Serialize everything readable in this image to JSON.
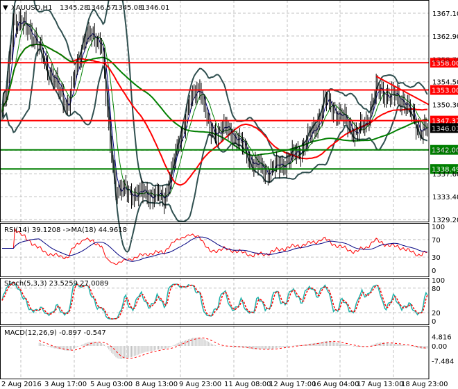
{
  "header": {
    "symbol": "XAUUSD,H1",
    "open": "1345.28",
    "high": "1346.57",
    "low": "1345.08",
    "close": "1346.01"
  },
  "colors": {
    "level_red": "#ff0000",
    "level_green": "#007f00",
    "ma_red": "#ff0000",
    "ma_green": "#007f00",
    "bands": "#2f4f4f",
    "rsi": "#ff0000",
    "rsi_ma": "#000080",
    "stoch_main": "#20b2aa",
    "stoch_signal": "#ff0000",
    "macd_hist": "#c0c0c0",
    "macd_signal": "#ff0000"
  },
  "chart_data": {
    "type": "candlestick",
    "title": "XAUUSD,H1",
    "price_ticks": [
      "1367.10",
      "1362.90",
      "1358.70",
      "1354.50",
      "1350.30",
      "1346.10",
      "1341.90",
      "1337.60",
      "1333.40",
      "1329.20"
    ],
    "price_ylim": [
      1329.2,
      1367.1
    ],
    "price_anchors": [
      [
        0,
        1349
      ],
      [
        3,
        1352
      ],
      [
        8,
        1366
      ],
      [
        20,
        1364
      ],
      [
        34,
        1356
      ],
      [
        46,
        1350
      ],
      [
        58,
        1363
      ],
      [
        70,
        1362
      ],
      [
        75,
        1345
      ],
      [
        80,
        1335
      ],
      [
        90,
        1334
      ],
      [
        102,
        1334
      ],
      [
        114,
        1333
      ],
      [
        122,
        1341
      ],
      [
        131,
        1350
      ],
      [
        139,
        1354
      ],
      [
        146,
        1345
      ],
      [
        156,
        1346
      ],
      [
        166,
        1344
      ],
      [
        175,
        1340
      ],
      [
        185,
        1338
      ],
      [
        195,
        1339
      ],
      [
        210,
        1342
      ],
      [
        220,
        1346
      ],
      [
        227,
        1351
      ],
      [
        239,
        1348
      ],
      [
        249,
        1345
      ],
      [
        256,
        1347
      ],
      [
        263,
        1353
      ],
      [
        273,
        1352
      ],
      [
        283,
        1351
      ],
      [
        292,
        1346
      ]
    ],
    "levels": [
      {
        "label": "1358.00",
        "value": 1358.0,
        "color": "red"
      },
      {
        "label": "1353.00",
        "value": 1353.0,
        "color": "red"
      },
      {
        "label": "1347.37",
        "value": 1347.37,
        "color": "red"
      },
      {
        "label": "1342.00",
        "value": 1342.0,
        "color": "green"
      },
      {
        "label": "1338.49",
        "value": 1338.49,
        "color": "green"
      }
    ],
    "current_price": {
      "label": "1346.01",
      "value": 1346.01
    },
    "trendline": [
      [
        263,
        1355.5
      ],
      [
        300,
        1350.3
      ]
    ],
    "time_labels": [
      "2 Aug 2016",
      "3 Aug 17:00",
      "5 Aug 03:00",
      "8 Aug 13:00",
      "9 Aug 23:00",
      "11 Aug 08:00",
      "12 Aug 17:00",
      "16 Aug 04:00",
      "17 Aug 13:00",
      "18 Aug 23:00"
    ],
    "rsi": {
      "label": "RSI(14) 39.1208  ->MA(18) 44.9618",
      "ticks": [
        "100",
        "70",
        "30",
        "0"
      ],
      "ylim": [
        0,
        100
      ]
    },
    "stoch": {
      "label": "Stoch(5,3,3) 23.5259 27.0089",
      "ticks": [
        "100",
        "80",
        "20",
        "0"
      ],
      "ylim": [
        0,
        100
      ]
    },
    "macd": {
      "label": "MACD(12,26,9) -0.897 -0.547",
      "ticks": [
        "4.816",
        "0.00",
        "-7.484"
      ],
      "ylim": [
        -7.484,
        4.816
      ]
    }
  }
}
